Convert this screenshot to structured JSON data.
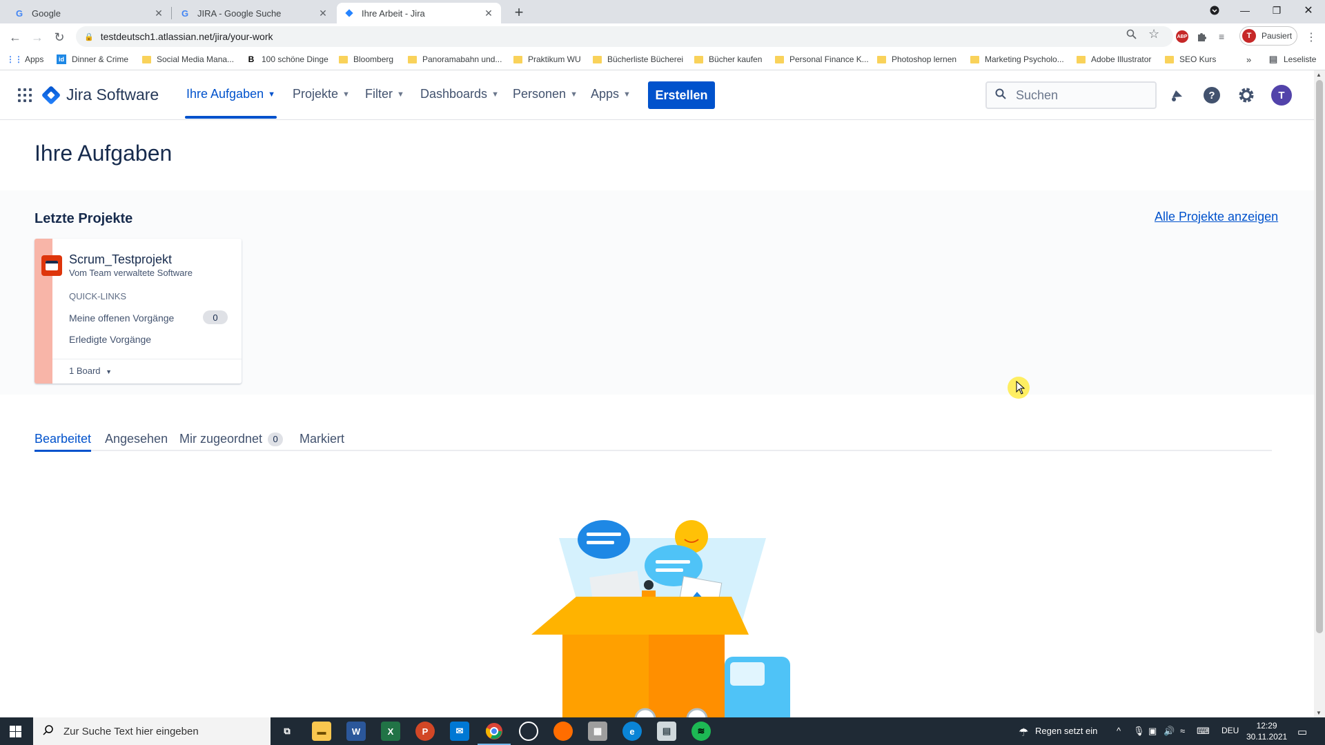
{
  "browser": {
    "tabs": [
      {
        "title": "Google",
        "favicon": "google-g-icon"
      },
      {
        "title": "JIRA - Google Suche",
        "favicon": "google-g-icon"
      },
      {
        "title": "Ihre Arbeit - Jira",
        "favicon": "jira-icon",
        "active": true
      }
    ],
    "url": "testdeutsch1.atlassian.net/jira/your-work",
    "profile_label": "Pausiert",
    "profile_initial": "T",
    "abp_label": "ABP",
    "reading_list": "Leseliste",
    "bookmarks": [
      {
        "label": "Apps",
        "icon": "apps-grid-icon"
      },
      {
        "label": "Dinner & Crime",
        "icon": "site-icon"
      },
      {
        "label": "Social Media Mana...",
        "icon": "folder-icon"
      },
      {
        "label": "100 schöne Dinge",
        "icon": "b-icon"
      },
      {
        "label": "Bloomberg",
        "icon": "folder-icon"
      },
      {
        "label": "Panoramabahn und...",
        "icon": "folder-icon"
      },
      {
        "label": "Praktikum WU",
        "icon": "folder-icon"
      },
      {
        "label": "Bücherliste Bücherei",
        "icon": "folder-icon"
      },
      {
        "label": "Bücher kaufen",
        "icon": "folder-icon"
      },
      {
        "label": "Personal Finance K...",
        "icon": "folder-icon"
      },
      {
        "label": "Photoshop lernen",
        "icon": "folder-icon"
      },
      {
        "label": "Marketing Psycholo...",
        "icon": "folder-icon"
      },
      {
        "label": "Adobe Illustrator",
        "icon": "folder-icon"
      },
      {
        "label": "SEO Kurs",
        "icon": "folder-icon"
      }
    ]
  },
  "jira": {
    "product_name": "Jira Software",
    "nav": [
      {
        "label": "Ihre Aufgaben",
        "active": true
      },
      {
        "label": "Projekte"
      },
      {
        "label": "Filter"
      },
      {
        "label": "Dashboards"
      },
      {
        "label": "Personen"
      },
      {
        "label": "Apps"
      }
    ],
    "create_label": "Erstellen",
    "search_placeholder": "Suchen",
    "user_initial": "T",
    "accent_color": "#0052cc"
  },
  "page": {
    "title": "Ihre Aufgaben",
    "recent_title": "Letzte Projekte",
    "all_projects_link": "Alle Projekte anzeigen",
    "project": {
      "name": "Scrum_Testprojekt",
      "subtitle": "Vom Team verwaltete Software",
      "quicklinks_heading": "QUICK-LINKS",
      "open_issues_label": "Meine offenen Vorgänge",
      "open_issues_count": "0",
      "done_issues_label": "Erledigte Vorgänge",
      "board_dropdown": "1 Board"
    },
    "work_tabs": [
      {
        "label": "Bearbeitet",
        "active": true
      },
      {
        "label": "Angesehen"
      },
      {
        "label": "Mir zugeordnet",
        "count": "0"
      },
      {
        "label": "Markiert"
      }
    ]
  },
  "taskbar": {
    "search_placeholder": "Zur Suche Text hier eingeben",
    "weather": "Regen setzt ein",
    "language": "DEU",
    "time": "12:29",
    "date": "30.11.2021"
  }
}
